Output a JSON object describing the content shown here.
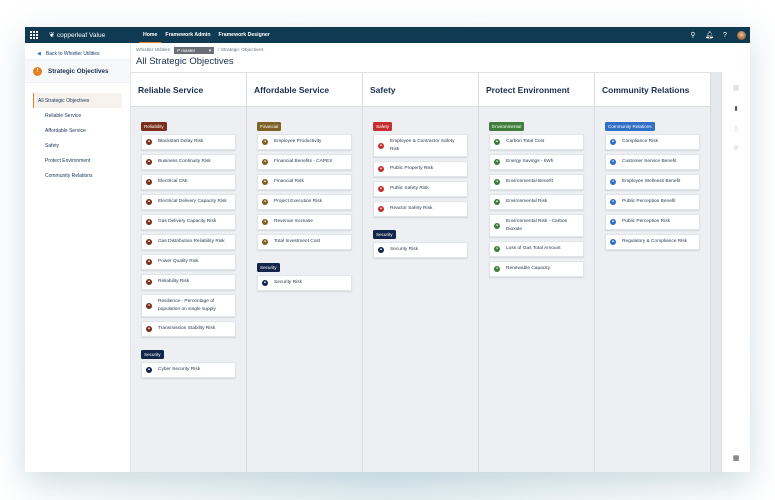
{
  "app": {
    "brand": "copperleaf Value",
    "nav": [
      {
        "label": "Home",
        "active": true
      },
      {
        "label": "Framework Admin",
        "active": false
      },
      {
        "label": "Framework Designer",
        "active": false
      }
    ],
    "icons": [
      "search-icon",
      "bell-icon",
      "help-icon",
      "user-avatar"
    ]
  },
  "sidebar": {
    "back_label": "Back to Whistler Utilities",
    "section_badge": "!",
    "section_title": "Strategic Objectives",
    "items": [
      {
        "label": "All Strategic Objectives",
        "active": true
      },
      {
        "label": "Reliable Service",
        "active": false
      },
      {
        "label": "Affordable Service",
        "active": false
      },
      {
        "label": "Safety",
        "active": false
      },
      {
        "label": "Protect Environment",
        "active": false
      },
      {
        "label": "Community Relations",
        "active": false
      }
    ]
  },
  "breadcrumb": {
    "root": "Whistler Utilities",
    "branch": "master",
    "branch_prefix": "P",
    "separator": "/",
    "current": "Strategic Objectives"
  },
  "page_title": "All Strategic Objectives",
  "columns": [
    {
      "title": "Reliable Service",
      "groups": [
        {
          "tag": "Reliability",
          "color": "#7a2e1b",
          "items": [
            {
              "label": "Blackstart Delay Risk",
              "icon": "risk"
            },
            {
              "label": "Business Continuity Risk",
              "icon": "risk"
            },
            {
              "label": "Electrical CMI",
              "icon": "value"
            },
            {
              "label": "Electrical Delivery Capacity Risk",
              "icon": "risk"
            },
            {
              "label": "Gas Delivery Capacity Risk",
              "icon": "risk"
            },
            {
              "label": "Gas Distribution Reliability Risk",
              "icon": "risk"
            },
            {
              "label": "Power Quality Risk",
              "icon": "risk"
            },
            {
              "label": "Reliability Risk",
              "icon": "risk"
            },
            {
              "label": "Resilience - Percentage of population on single supply",
              "icon": "value"
            },
            {
              "label": "Transmission Stability Risk",
              "icon": "risk"
            }
          ]
        },
        {
          "tag": "Security",
          "color": "#14254a",
          "items": [
            {
              "label": "Cyber Security Risk",
              "icon": "risk"
            }
          ]
        }
      ]
    },
    {
      "title": "Affordable Service",
      "groups": [
        {
          "tag": "Financial",
          "color": "#7d6125",
          "items": [
            {
              "label": "Employee Productivity",
              "icon": "value"
            },
            {
              "label": "Financial Benefits - CAPEX",
              "icon": "value"
            },
            {
              "label": "Financial Risk",
              "icon": "risk"
            },
            {
              "label": "Project Execution Risk",
              "icon": "value"
            },
            {
              "label": "Revenue Increase",
              "icon": "value"
            },
            {
              "label": "Total Investment Cost",
              "icon": "value"
            }
          ]
        },
        {
          "tag": "Security",
          "color": "#14254a",
          "items": [
            {
              "label": "Security Risk",
              "icon": "risk"
            }
          ]
        }
      ]
    },
    {
      "title": "Safety",
      "groups": [
        {
          "tag": "Safety",
          "color": "#c62f2f",
          "items": [
            {
              "label": "Employee & Contractor Safety Risk",
              "icon": "risk"
            },
            {
              "label": "Public Property Risk",
              "icon": "risk"
            },
            {
              "label": "Public Safety Risk",
              "icon": "risk"
            },
            {
              "label": "Reactor Safety Risk",
              "icon": "risk"
            }
          ]
        },
        {
          "tag": "Security",
          "color": "#14254a",
          "items": [
            {
              "label": "Security Risk",
              "icon": "risk"
            }
          ]
        }
      ]
    },
    {
      "title": "Protect Environment",
      "groups": [
        {
          "tag": "Environmental",
          "color": "#3e7d3a",
          "items": [
            {
              "label": "Carbon Total Cost",
              "icon": "risk"
            },
            {
              "label": "Energy Savings - kWh",
              "icon": "value"
            },
            {
              "label": "Environmental Benefit",
              "icon": "value"
            },
            {
              "label": "Environmental Risk",
              "icon": "risk"
            },
            {
              "label": "Environmental Risk - Carbon Dioxide",
              "icon": "value"
            },
            {
              "label": "Loss of Gas Total Amount",
              "icon": "value"
            },
            {
              "label": "Renewable Capacity",
              "icon": "value"
            }
          ]
        }
      ]
    },
    {
      "title": "Community Relations",
      "groups": [
        {
          "tag": "Community Relations",
          "color": "#2f6fc6",
          "items": [
            {
              "label": "Compliance Risk",
              "icon": "risk"
            },
            {
              "label": "Customer Service Benefit",
              "icon": "value"
            },
            {
              "label": "Employee Wellness Benefit",
              "icon": "value"
            },
            {
              "label": "Public Perception Benefit",
              "icon": "value"
            },
            {
              "label": "Public Perception Risk",
              "icon": "risk"
            },
            {
              "label": "Regulatory & Compliance Risk",
              "icon": "risk"
            }
          ]
        }
      ]
    }
  ],
  "right_rail": [
    "link-icon",
    "notebook-icon",
    "document-icon",
    "zoom-icon"
  ],
  "bottom_rail_icon": "columns-icon"
}
